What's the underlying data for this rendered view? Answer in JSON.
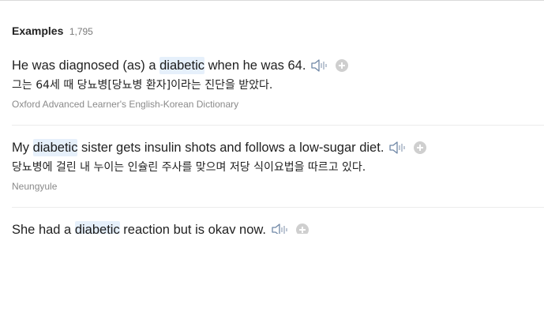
{
  "examples_section": {
    "title": "Examples",
    "count": "1,795"
  },
  "examples": [
    {
      "before": "He was diagnosed (as) a ",
      "keyword": "diabetic",
      "after": " when he was 64.",
      "korean": "그는 64세 때 당뇨병[당뇨병 환자]이라는 진단을 받았다.",
      "source": "Oxford Advanced Learner's English-Korean Dictionary"
    },
    {
      "before": "My ",
      "keyword": "diabetic",
      "after": " sister gets insulin shots and follows a low-sugar diet.",
      "korean": "당뇨병에 걸린 내 누이는 인슐린 주사를 맞으며 저당 식이요법을 따르고 있다.",
      "source": "Neungyule"
    },
    {
      "before": "She had a ",
      "keyword": "diabetic",
      "after": " reaction but is okay now."
    }
  ],
  "icons": {
    "speaker": "speaker-icon",
    "add": "plus-circle-icon"
  },
  "colors": {
    "keyword_highlight": "#e6f0fb",
    "source_text": "#8a8a8a",
    "count_text": "#7a7a7a"
  }
}
